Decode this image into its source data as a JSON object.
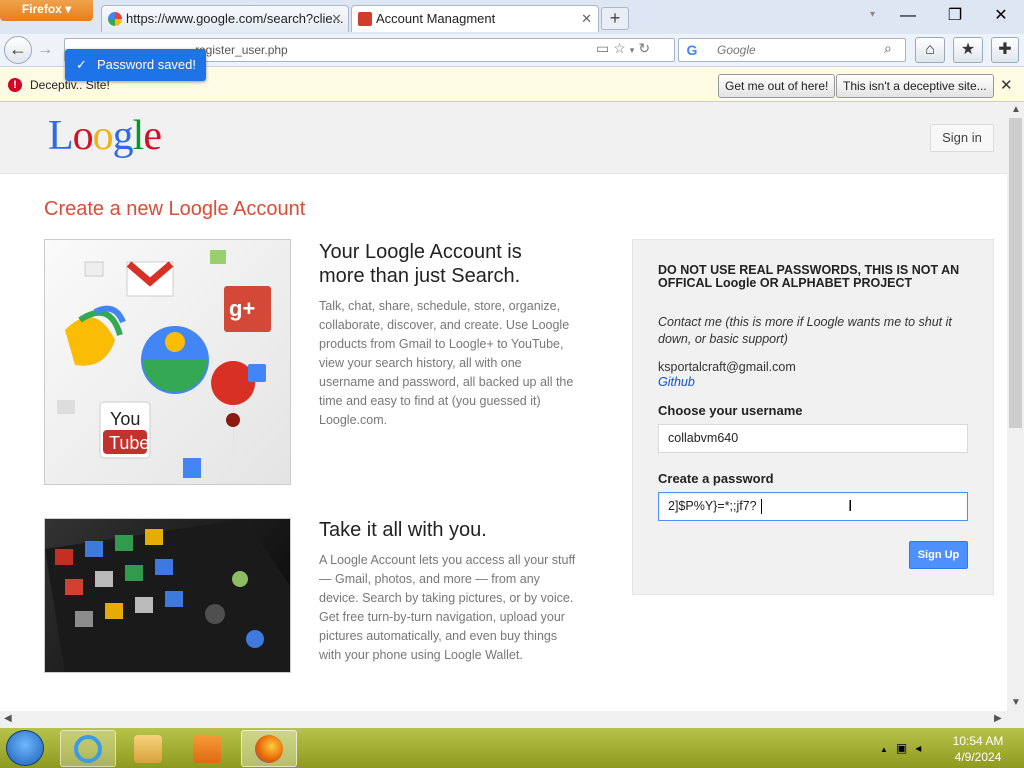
{
  "browser": {
    "menu_label": "Firefox",
    "tabs": [
      {
        "title": "https://www.google.com/search?clie...",
        "active": false
      },
      {
        "title": "Account Managment",
        "active": true
      }
    ],
    "new_tab_label": "+",
    "url": "register_user.php",
    "search_placeholder": "Google"
  },
  "toast": {
    "text": "Password saved!"
  },
  "notification": {
    "text": "Deceptiv.. Site!",
    "btn_get_out": "Get me out of here!",
    "btn_not_deceptive": "This isn't a deceptive site..."
  },
  "site": {
    "logo_letters": [
      "L",
      "o",
      "o",
      "g",
      "l",
      "e"
    ],
    "logo_colors": [
      "#3369e8",
      "#d50f25",
      "#eeb211",
      "#3369e8",
      "#009925",
      "#d50f25"
    ],
    "signin_label": "Sign in",
    "heading": "Create a new Loogle Account",
    "section1": {
      "title": "Your Loogle Account is more than just Search.",
      "text": "Talk, chat, share, schedule, store, organize, collaborate, discover, and create. Use Loogle products from Gmail to Loogle+ to YouTube, view your search history, all with one username and password, all backed up all the time and easy to find at (you guessed it) Loogle.com."
    },
    "section2": {
      "title": "Take it all with you.",
      "text": "A Loogle Account lets you access all your stuff — Gmail, photos, and more — from any device. Search by taking pictures, or by voice. Get free turn-by-turn navigation, upload your pictures automatically, and even buy things with your phone using Loogle Wallet."
    }
  },
  "form": {
    "warning": "DO NOT USE REAL PASSWORDS, THIS IS NOT AN OFFICAL Loogle OR ALPHABET PROJECT",
    "contact": "Contact me (this is more if Loogle wants me to shut it down, or basic support)",
    "email": "ksportalcraft@gmail.com",
    "github": "Github",
    "username_label": "Choose your username",
    "username_value": "collabvm640",
    "password_label": "Create a password",
    "password_value": "2]$P%Y}=*;;jf7?",
    "signup_label": "Sign Up"
  },
  "taskbar": {
    "time": "10:54 AM",
    "date": "4/9/2024"
  }
}
